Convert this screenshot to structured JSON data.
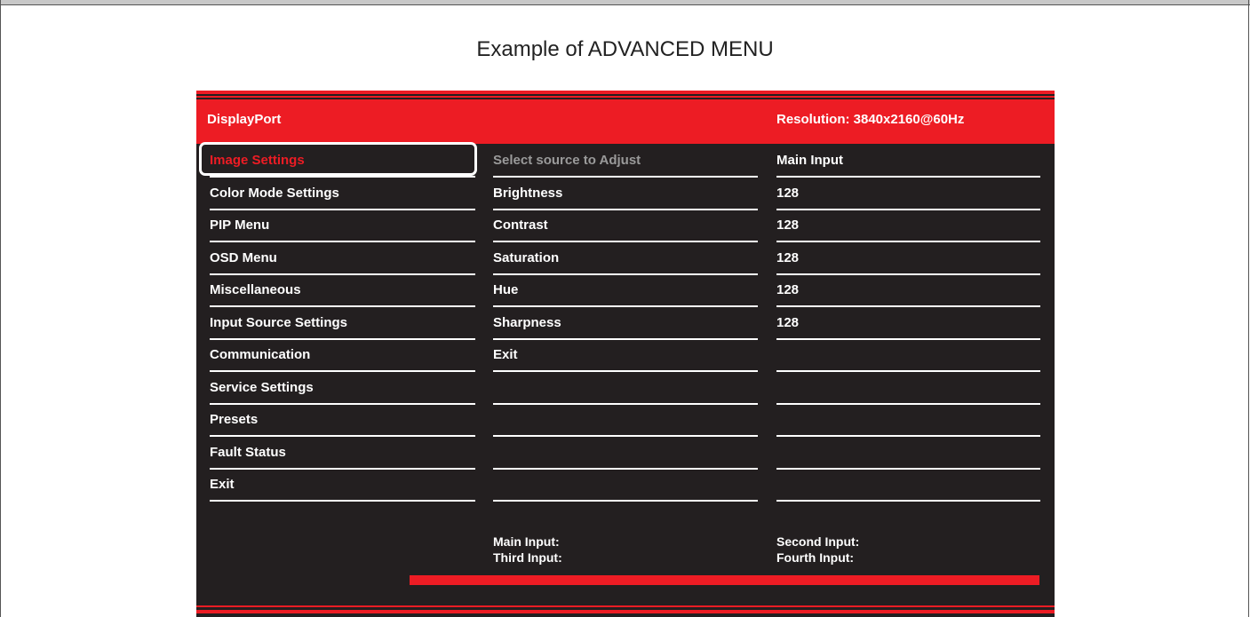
{
  "caption": "Example of ADVANCED MENU",
  "header": {
    "source": "DisplayPort",
    "resolution": "Resolution: 3840x2160@60Hz"
  },
  "menu": {
    "items": [
      {
        "label": "Image Settings",
        "selected": true
      },
      {
        "label": "Color Mode Settings"
      },
      {
        "label": "PIP Menu"
      },
      {
        "label": "OSD Menu"
      },
      {
        "label": "Miscellaneous"
      },
      {
        "label": "Input Source Settings"
      },
      {
        "label": "Communication"
      },
      {
        "label": "Service Settings"
      },
      {
        "label": "Presets"
      },
      {
        "label": "Fault Status"
      },
      {
        "label": "Exit"
      }
    ]
  },
  "settings": {
    "items": [
      {
        "label": "Select source to Adjust",
        "value": "Main Input"
      },
      {
        "label": "Brightness",
        "value": "128"
      },
      {
        "label": "Contrast",
        "value": "128"
      },
      {
        "label": "Saturation",
        "value": "128"
      },
      {
        "label": "Hue",
        "value": "128"
      },
      {
        "label": "Sharpness",
        "value": "128"
      },
      {
        "label": "Exit",
        "value": ""
      },
      {
        "label": "",
        "value": ""
      },
      {
        "label": "",
        "value": ""
      },
      {
        "label": "",
        "value": ""
      },
      {
        "label": "",
        "value": ""
      }
    ]
  },
  "footer": {
    "main_input": "Main Input:",
    "third_input": "Third Input:",
    "second_input": "Second Input:",
    "fourth_input": "Fourth Input:"
  },
  "colors": {
    "accent": "#ed1c24",
    "panel": "#231f20",
    "text": "#ffffff",
    "dim_text": "#9a9a9a"
  }
}
